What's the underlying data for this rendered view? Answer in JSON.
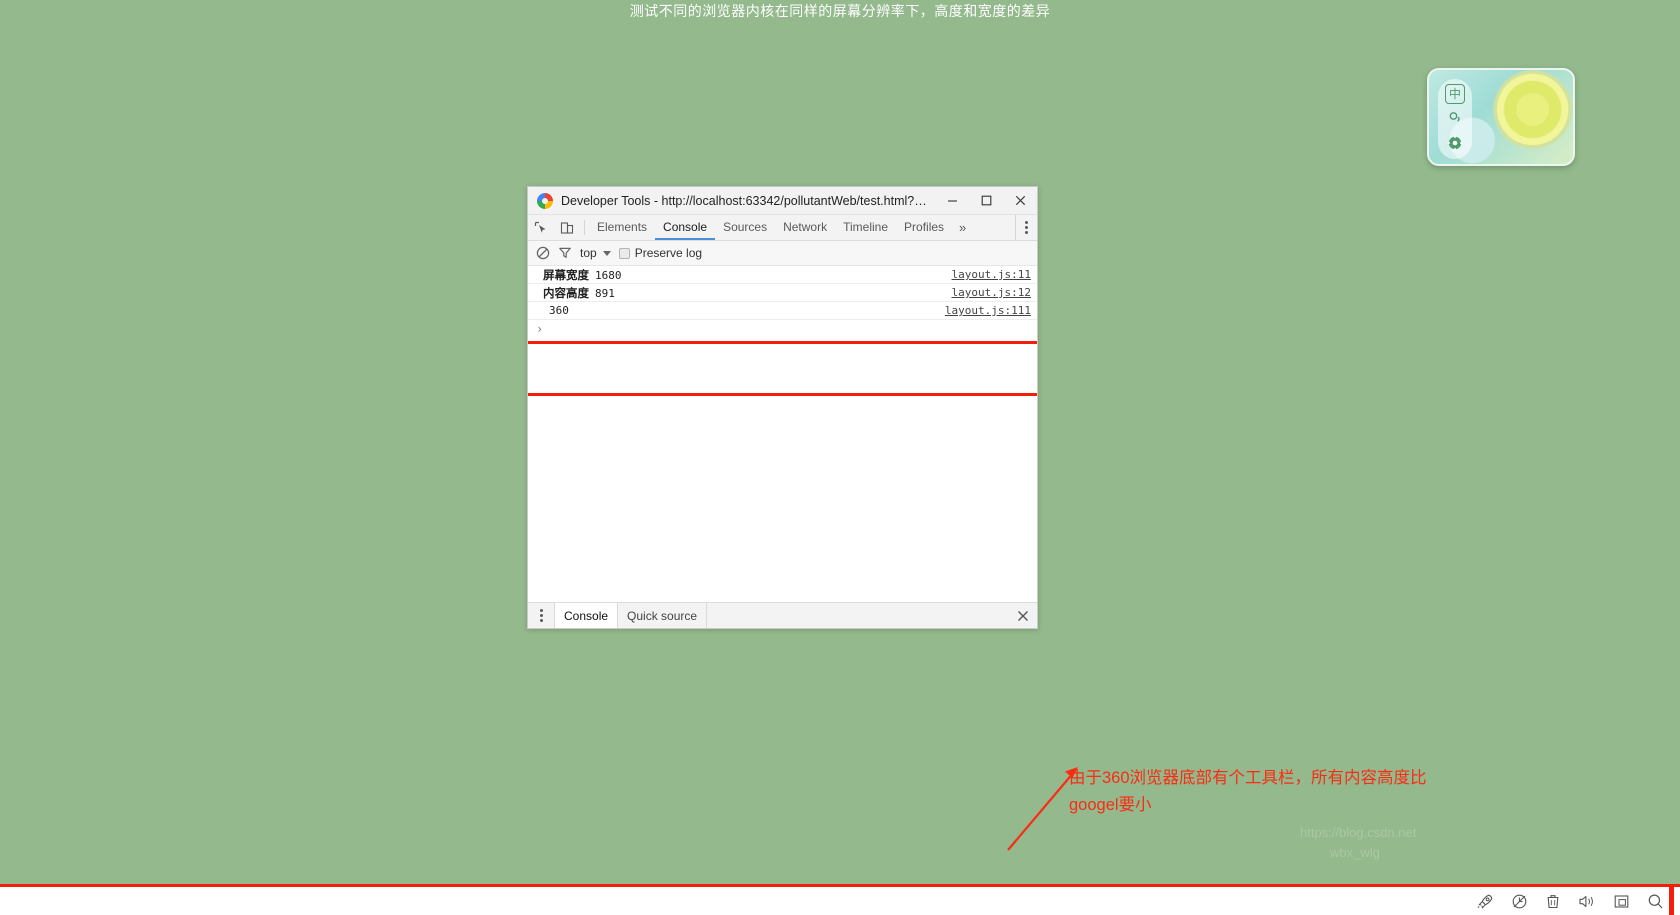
{
  "page": {
    "title": "测试不同的浏览器内核在同样的屏幕分辨率下，高度和宽度的差异",
    "background_color": "#93b98c",
    "accent_red": "#f41e0c"
  },
  "ime_panel": {
    "mode_label": "中",
    "punctuation_icon": "punctuation-icon",
    "settings_icon": "gear-icon"
  },
  "devtools": {
    "window_title": "Developer Tools - http://localhost:63342/pollutantWeb/test.html?_ij...",
    "favicon": "chrome-logo-icon",
    "window_buttons": {
      "minimize": "minimize-icon",
      "maximize": "maximize-icon",
      "close": "close-icon"
    },
    "toolbar": {
      "inspect_icon": "inspect-element-icon",
      "device_icon": "toggle-device-toolbar-icon",
      "tabs": [
        {
          "label": "Elements",
          "active": false
        },
        {
          "label": "Console",
          "active": true
        },
        {
          "label": "Sources",
          "active": false
        },
        {
          "label": "Network",
          "active": false
        },
        {
          "label": "Timeline",
          "active": false
        },
        {
          "label": "Profiles",
          "active": false
        }
      ],
      "more_label": "»",
      "menu_icon": "kebab-menu-icon"
    },
    "console_bar": {
      "clear_icon": "clear-console-icon",
      "filter_icon": "filter-icon",
      "context_value": "top",
      "preserve_log_label": "Preserve log",
      "preserve_log_checked": false
    },
    "console_messages": [
      {
        "label": "屏幕宽度",
        "value": "1680",
        "source": "layout.js:11"
      },
      {
        "label": "内容高度",
        "value": "891",
        "source": "layout.js:12"
      },
      {
        "label": "",
        "value": "360",
        "source": "layout.js:111"
      }
    ],
    "console_prompt": "›",
    "drawer": {
      "menu_icon": "kebab-menu-icon",
      "tabs": [
        {
          "label": "Console",
          "active": true
        },
        {
          "label": "Quick source",
          "active": false
        }
      ],
      "close_icon": "close-icon"
    }
  },
  "annotation": {
    "line1": "由于360浏览器底部有个工具栏，所有内容高度比",
    "line2": "googel要小",
    "color": "#fa2c14",
    "arrow": "arrow-pointing-up-right"
  },
  "taskbar": {
    "icons": [
      "rocket-icon",
      "shield-icon",
      "trash-icon",
      "speaker-icon",
      "window-icon",
      "search-icon"
    ]
  },
  "watermarks": {
    "main": "https://blog.csdn.net/wbx_wlg",
    "faint1": "https://blog.csdn.net",
    "faint2": "wbx_wlg"
  }
}
